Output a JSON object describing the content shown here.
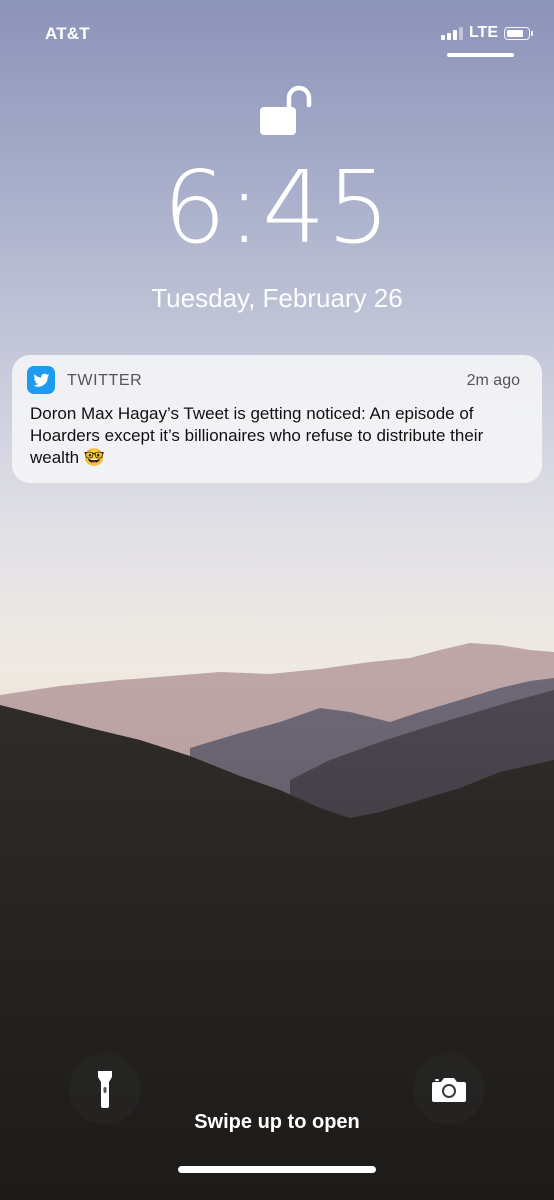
{
  "status_bar": {
    "carrier": "AT&T",
    "network": "LTE",
    "signal_bars": 4,
    "signal_bars_active": 3,
    "battery_level": 0.85
  },
  "lock": {
    "icon": "unlocked-padlock-icon",
    "time": "6:45",
    "date": "Tuesday, February 26"
  },
  "notification": {
    "app_icon": "twitter-bird-icon",
    "app_name": "TWITTER",
    "timestamp": "2m ago",
    "message": "Doron Max Hagay’s Tweet is getting noticed: An episode of Hoarders except it’s billionaires who refuse to distribute their wealth 🤓"
  },
  "bottom": {
    "flashlight_icon": "flashlight-icon",
    "camera_icon": "camera-icon",
    "swipe_hint": "Swipe up to open"
  },
  "colors": {
    "twitter_blue": "#1d9bf0"
  }
}
